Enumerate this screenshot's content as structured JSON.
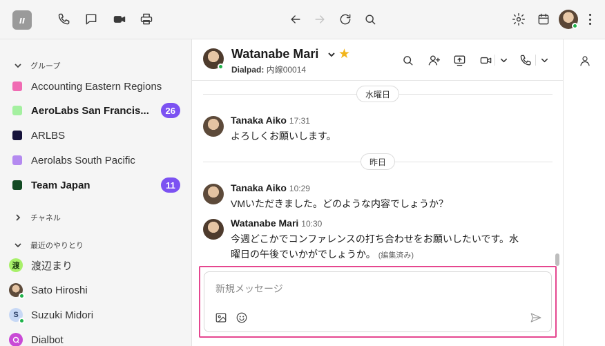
{
  "app": {
    "logo_text": "ıı",
    "colors": {
      "accent": "#7c52f2",
      "focus": "#e5468f",
      "presence": "#1fb24a",
      "star": "#f2b51c"
    }
  },
  "toolbar": {
    "icons": [
      "phone-icon",
      "chat-icon",
      "video-icon",
      "printer-icon",
      "back-arrow-icon",
      "forward-arrow-icon",
      "refresh-icon",
      "search-icon",
      "gear-icon",
      "calendar-icon",
      "kebab-menu-icon"
    ]
  },
  "sidebar": {
    "groups_label": "グループ",
    "groups": [
      {
        "label": "Accounting Eastern Regions",
        "color": "#f06bb3",
        "bold": false,
        "badge": ""
      },
      {
        "label": "AeroLabs San Francis...",
        "color": "#a4f0a0",
        "bold": true,
        "badge": "26"
      },
      {
        "label": "ARLBS",
        "color": "#15123a",
        "bold": false,
        "badge": ""
      },
      {
        "label": "Aerolabs South Pacific",
        "color": "#b48af0",
        "bold": false,
        "badge": ""
      },
      {
        "label": "Team Japan",
        "color": "#124a23",
        "bold": true,
        "badge": "11"
      }
    ],
    "channels_label": "チャネル",
    "recent_label": "最近のやりとり",
    "recent": [
      {
        "label": "渡辺まり",
        "avatar_text": "渡",
        "avatar_bg": "#a8f06a",
        "photo": false,
        "presence": false
      },
      {
        "label": "Sato Hiroshi",
        "avatar_text": "",
        "avatar_bg": "",
        "photo": true,
        "presence": true
      },
      {
        "label": "Suzuki Midori",
        "avatar_text": "S",
        "avatar_bg": "#c7d8f5",
        "photo": false,
        "presence": true
      },
      {
        "label": "Dialbot",
        "avatar_text": "",
        "avatar_bg": "#c94ad6",
        "photo": false,
        "presence": false
      }
    ]
  },
  "chat": {
    "contact_name": "Watanabe Mari",
    "sub_label": "Dialpad:",
    "sub_value": "内線00014",
    "day1": "水曜日",
    "day2": "昨日",
    "messages": [
      {
        "author": "Tanaka Aiko",
        "time": "17:31",
        "text": "よろしくお願いします。",
        "edited": ""
      },
      {
        "author": "Tanaka Aiko",
        "time": "10:29",
        "text": "VMいただきました。どのような内容でしょうか？",
        "edited": ""
      },
      {
        "author": "Watanabe Mari",
        "time": "10:30",
        "text": "今週どこかでコンファレンスの打ち合わせをお願いしたいです。水曜日の午後でいかがでしょうか。",
        "edited": "(編集済み)"
      }
    ],
    "composer": {
      "placeholder": "新規メッセージ",
      "value": ""
    }
  }
}
